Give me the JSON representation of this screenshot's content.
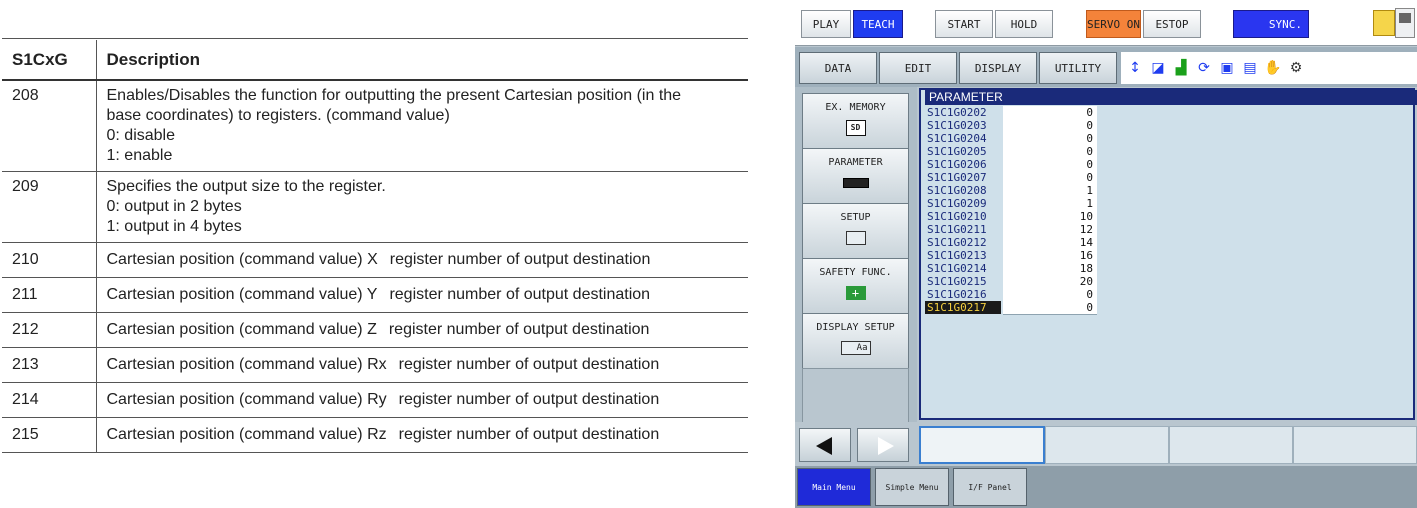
{
  "doc": {
    "headers": [
      "S1CxG",
      "Description"
    ],
    "rows": [
      {
        "id": "208",
        "lines": [
          "Enables/Disables the function for outputting the present Cartesian position (in the",
          "base coordinates) to registers.  (command value)",
          "0: disable",
          "1: enable"
        ]
      },
      {
        "id": "209",
        "lines": [
          "Specifies the output size to the register.",
          "0: output in 2 bytes",
          "1: output in 4 bytes"
        ]
      },
      {
        "id": "210",
        "desc": "Cartesian position (command value) X",
        "reg": "register number of output destination"
      },
      {
        "id": "211",
        "desc": "Cartesian position (command value) Y",
        "reg": "register number of output destination"
      },
      {
        "id": "212",
        "desc": "Cartesian position (command value) Z",
        "reg": "register number of output destination"
      },
      {
        "id": "213",
        "desc": "Cartesian position (command value) Rx",
        "reg": "register number of output destination"
      },
      {
        "id": "214",
        "desc": "Cartesian position (command value) Ry",
        "reg": "register number of output destination"
      },
      {
        "id": "215",
        "desc": "Cartesian position (command value) Rz",
        "reg": "register number of output destination"
      }
    ]
  },
  "pendant": {
    "topbar": {
      "play": "PLAY",
      "teach": "TEACH",
      "start": "START",
      "hold": "HOLD",
      "servo_on": "SERVO ON",
      "estop": "ESTOP",
      "sync": "SYNC."
    },
    "menu": {
      "data": "DATA",
      "edit": "EDIT",
      "display": "DISPLAY",
      "utility": "UTILITY"
    },
    "side": {
      "ex_memory": "EX. MEMORY",
      "parameter": "PARAMETER",
      "setup": "SETUP",
      "safety": "SAFETY FUNC.",
      "display_setup": "DISPLAY SETUP"
    },
    "side_icons": {
      "sd": "SD",
      "aa": "Aa"
    },
    "param_title": "PARAMETER",
    "params": [
      {
        "name": "S1C1G0202",
        "value": "0"
      },
      {
        "name": "S1C1G0203",
        "value": "0"
      },
      {
        "name": "S1C1G0204",
        "value": "0"
      },
      {
        "name": "S1C1G0205",
        "value": "0"
      },
      {
        "name": "S1C1G0206",
        "value": "0"
      },
      {
        "name": "S1C1G0207",
        "value": "0"
      },
      {
        "name": "S1C1G0208",
        "value": "1"
      },
      {
        "name": "S1C1G0209",
        "value": "1"
      },
      {
        "name": "S1C1G0210",
        "value": "10"
      },
      {
        "name": "S1C1G0211",
        "value": "12"
      },
      {
        "name": "S1C1G0212",
        "value": "14"
      },
      {
        "name": "S1C1G0213",
        "value": "16"
      },
      {
        "name": "S1C1G0214",
        "value": "18"
      },
      {
        "name": "S1C1G0215",
        "value": "20"
      },
      {
        "name": "S1C1G0216",
        "value": "0"
      },
      {
        "name": "S1C1G0217",
        "value": "0"
      }
    ],
    "tabs": {
      "main": "Main Menu",
      "simple": "Simple Menu",
      "if": "I/F Panel"
    }
  }
}
